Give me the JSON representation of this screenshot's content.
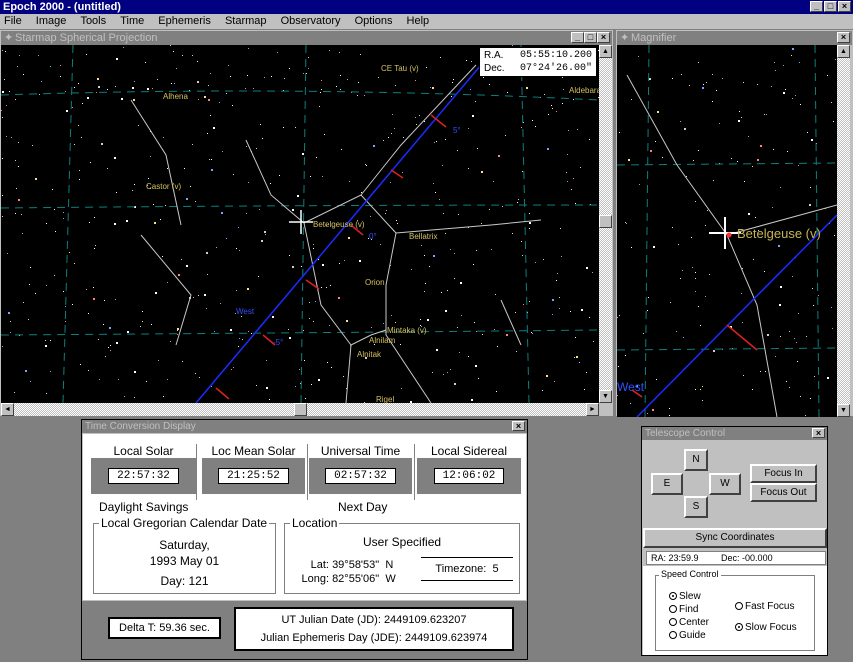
{
  "app": {
    "title": "Epoch 2000 - (untitled)"
  },
  "menu": [
    "File",
    "Image",
    "Tools",
    "Time",
    "Ephemeris",
    "Starmap",
    "Observatory",
    "Options",
    "Help"
  ],
  "starmap": {
    "title": "Starmap   Spherical Projection",
    "ra_label": "R.A.",
    "ra_value": "05:55:10.200",
    "dec_label": "Dec.",
    "dec_value": "07°24'26.00\"",
    "labels": [
      "CE Tau (v)",
      "Aldebaran",
      "Alhena",
      "Castor (v)",
      "Bellatrix",
      "Betelgeuse (v)",
      "Orion",
      "Alnitak",
      "Mintaka (v)",
      "Alnilam",
      "West",
      "Rigel"
    ],
    "ecliptic_marks": [
      "5°",
      "0°",
      "-5°"
    ]
  },
  "magnifier": {
    "title": "Magnifier",
    "star_label": "Betelgeuse (v)",
    "west_label": "West"
  },
  "time_display": {
    "title": "Time Conversion Display",
    "local_solar_label": "Local Solar",
    "local_solar": "22:57:32",
    "loc_mean_solar_label": "Loc Mean Solar",
    "loc_mean_solar": "21:25:52",
    "universal_label": "Universal Time",
    "universal": "02:57:32",
    "sidereal_label": "Local Sidereal",
    "sidereal": "12:06:02",
    "daylight": "Daylight Savings",
    "next_day": "Next Day",
    "calendar_label": "Local Gregorian Calendar Date",
    "weekday": "Saturday,",
    "date": "1993 May 01",
    "day": "Day: 121",
    "location_label": "Location",
    "location_name": "User Specified",
    "lat_label": "Lat:",
    "lat_value": "39°58'53\"",
    "lat_dir": "N",
    "long_label": "Long:",
    "long_value": "82°55'06\"",
    "long_dir": "W",
    "timezone_label": "Timezone:",
    "timezone_value": "5",
    "delta_t": "Delta T:  59.36 sec.",
    "jd": "UT Julian Date (JD): 2449109.623207",
    "jde": "Julian Ephemeris Day (JDE): 2449109.623974"
  },
  "telescope": {
    "title": "Telescope Control",
    "n": "N",
    "s": "S",
    "e": "E",
    "w": "W",
    "focus_in": "Focus In",
    "focus_out": "Focus Out",
    "sync": "Sync Coordinates",
    "ra_readout": "RA: 23:59.9",
    "dec_readout": "Dec: -00.000",
    "speed_label": "Speed Control",
    "speeds": [
      "Slew",
      "Find",
      "Center",
      "Guide"
    ],
    "focus_speeds": [
      "Fast Focus",
      "Slow Focus"
    ]
  }
}
